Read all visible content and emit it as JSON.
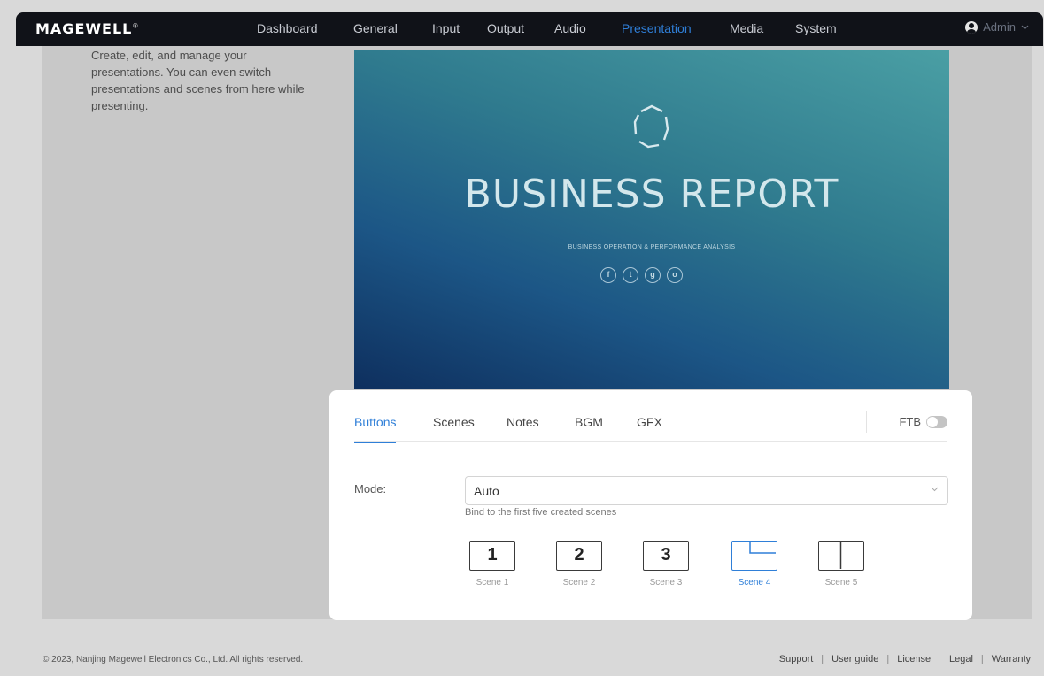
{
  "header": {
    "logo": "MAGEWELL",
    "logo_mark": "®",
    "nav": [
      {
        "label": "Dashboard",
        "active": false
      },
      {
        "label": "General",
        "active": false
      },
      {
        "label": "Input",
        "active": false
      },
      {
        "label": "Output",
        "active": false
      },
      {
        "label": "Audio",
        "active": false
      },
      {
        "label": "Presentation",
        "active": true
      },
      {
        "label": "Media",
        "active": false
      },
      {
        "label": "System",
        "active": false
      }
    ],
    "user": "Admin",
    "accent_color": "#2f7fd8"
  },
  "description": "Create, edit, and manage your presentations. You can even switch presentations and scenes from here while presenting.",
  "slide": {
    "title": "BUSINESS REPORT",
    "subtitle": "BUSINESS OPERATION & PERFORMANCE ANALYSIS",
    "social_icons": [
      "f",
      "t",
      "g",
      "o"
    ]
  },
  "panel": {
    "tabs": [
      {
        "label": "Buttons",
        "active": true
      },
      {
        "label": "Scenes",
        "active": false
      },
      {
        "label": "Notes",
        "active": false
      },
      {
        "label": "BGM",
        "active": false
      },
      {
        "label": "GFX",
        "active": false
      }
    ],
    "ftb_label": "FTB",
    "ftb_on": false,
    "mode_label": "Mode:",
    "mode_value": "Auto",
    "mode_hint": "Bind to the first five created scenes",
    "scenes": [
      {
        "number": "1",
        "label": "Scene 1",
        "active": false
      },
      {
        "number": "2",
        "label": "Scene 2",
        "active": false
      },
      {
        "number": "3",
        "label": "Scene 3",
        "active": false
      },
      {
        "number": "",
        "label": "Scene 4",
        "active": true,
        "icon": "layout-pip-icon"
      },
      {
        "number": "",
        "label": "Scene 5",
        "active": false,
        "icon": "layout-split-icon"
      }
    ]
  },
  "footer": {
    "copyright": "© 2023, Nanjing Magewell Electronics Co., Ltd. All rights reserved.",
    "links": [
      "Support",
      "User guide",
      "License",
      "Legal",
      "Warranty"
    ]
  }
}
